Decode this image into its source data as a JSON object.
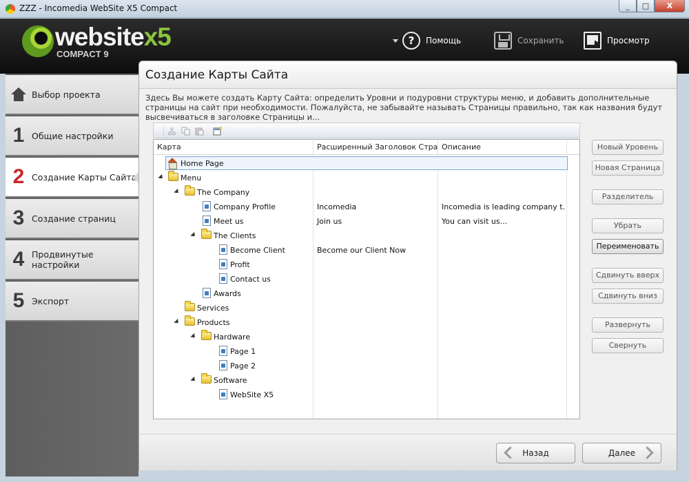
{
  "window": {
    "title": "ZZZ - Incomedia WebSite X5 Compact",
    "controls": [
      "_",
      "□",
      "X"
    ]
  },
  "logo": {
    "main": "website",
    "x5": "x5",
    "sub": "COMPACT 9"
  },
  "header_tools": {
    "help": "Помощь",
    "save": "Сохранить",
    "preview": "Просмотр"
  },
  "steps": [
    {
      "num": "",
      "label": "Выбор проекта",
      "icon": "home-icon"
    },
    {
      "num": "1",
      "label": "Общие настройки"
    },
    {
      "num": "2",
      "label": "Создание Карты Сайта"
    },
    {
      "num": "3",
      "label": "Создание страниц"
    },
    {
      "num": "4",
      "label": "Продвинутые настройки"
    },
    {
      "num": "5",
      "label": "Экспорт"
    }
  ],
  "panel": {
    "title": "Создание Карты Сайта",
    "description": "Здесь Вы можете создать Карту Сайта: определить Уровни и подуровни структуры меню, и добавить дополнительные страницы на сайт при необходимости. Пожалуйста, не забывайте называть Страницы правильно, так как названия будут высвечиваться в заголовке Страницы и..."
  },
  "tree": {
    "columns": [
      "Карта",
      "Расширенный Заголовок Страни...",
      "Описание"
    ],
    "rows": [
      {
        "name": "Home Page",
        "type": "home",
        "title": "",
        "desc": ""
      },
      {
        "name": "Menu",
        "type": "folder",
        "title": "",
        "desc": ""
      },
      {
        "name": "The Company",
        "type": "folder",
        "title": "",
        "desc": ""
      },
      {
        "name": "Company Profile",
        "type": "page",
        "title": "Incomedia",
        "desc": "Incomedia is leading company t..."
      },
      {
        "name": "Meet us",
        "type": "page",
        "title": "Join us",
        "desc": "You can visit us..."
      },
      {
        "name": "The Clients",
        "type": "folder",
        "title": "",
        "desc": ""
      },
      {
        "name": "Become Client",
        "type": "page",
        "title": "Become our Client Now",
        "desc": ""
      },
      {
        "name": "Profit",
        "type": "page",
        "title": "",
        "desc": ""
      },
      {
        "name": "Contact us",
        "type": "page",
        "title": "",
        "desc": ""
      },
      {
        "name": "Awards",
        "type": "page",
        "title": "",
        "desc": ""
      },
      {
        "name": "Services",
        "type": "folder",
        "title": "",
        "desc": ""
      },
      {
        "name": "Products",
        "type": "folder",
        "title": "",
        "desc": ""
      },
      {
        "name": "Hardware",
        "type": "folder",
        "title": "",
        "desc": ""
      },
      {
        "name": "Page 1",
        "type": "page",
        "title": "",
        "desc": ""
      },
      {
        "name": "Page 2",
        "type": "page",
        "title": "",
        "desc": ""
      },
      {
        "name": "Software",
        "type": "folder",
        "title": "",
        "desc": ""
      },
      {
        "name": "WebSite X5",
        "type": "page",
        "title": "",
        "desc": ""
      }
    ]
  },
  "actions": {
    "new_level": "Новый Уровень",
    "new_page": "Новая Страница",
    "separator": "Разделитель",
    "remove": "Убрать",
    "rename": "Переименовать",
    "move_up": "Сдвинуть вверх",
    "move_down": "Сдвинуть вниз",
    "expand": "Развернуть",
    "collapse": "Свернуть"
  },
  "nav": {
    "back": "Назад",
    "next": "Далее"
  }
}
